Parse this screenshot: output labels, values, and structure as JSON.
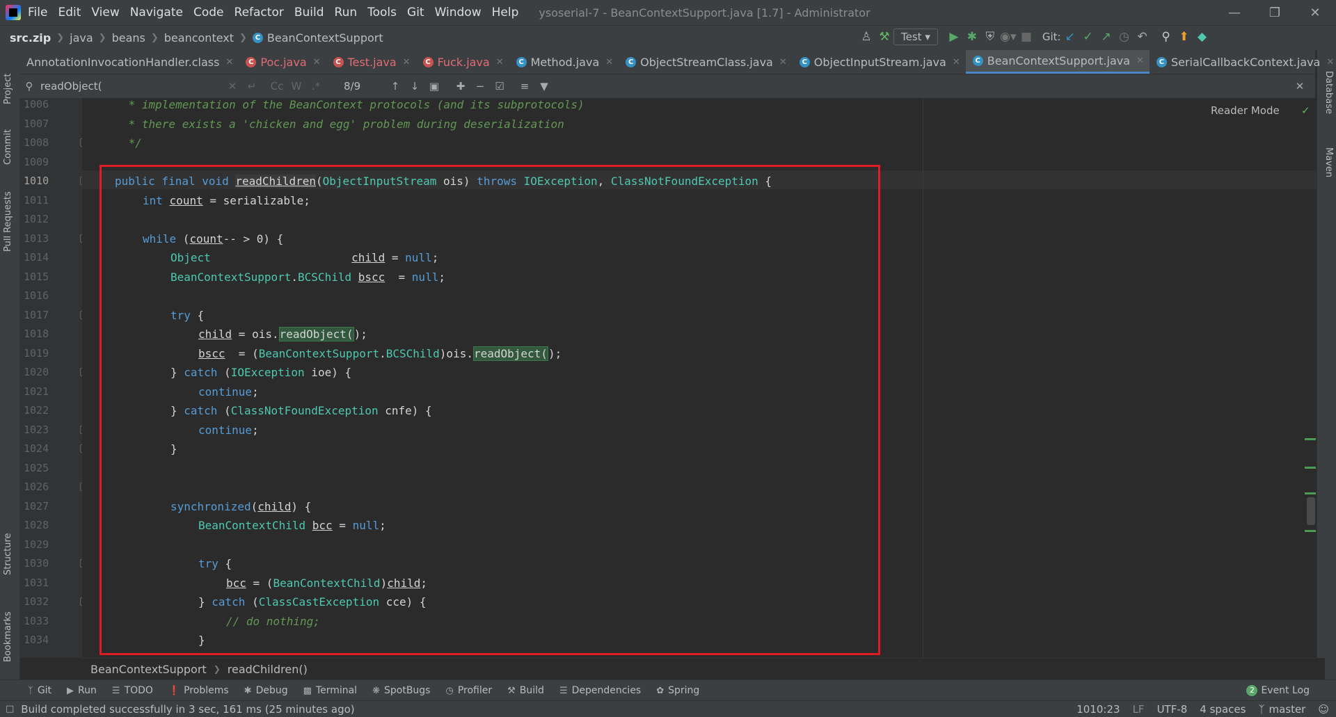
{
  "menubar": {
    "items": [
      "File",
      "Edit",
      "View",
      "Navigate",
      "Code",
      "Refactor",
      "Build",
      "Run",
      "Tools",
      "Git",
      "Window",
      "Help"
    ],
    "window_title": "ysoserial-7 - BeanContextSupport.java [1.7] - Administrator"
  },
  "navbar": {
    "crumbs": [
      "src.zip",
      "java",
      "beans",
      "beancontext",
      "BeanContextSupport"
    ],
    "run_config": "Test",
    "git_label": "Git:"
  },
  "tabs": [
    {
      "label": "AnnotationInvocationHandler.class",
      "error": false,
      "active": false
    },
    {
      "label": "Poc.java",
      "error": true,
      "active": false
    },
    {
      "label": "Test.java",
      "error": true,
      "active": false
    },
    {
      "label": "Fuck.java",
      "error": true,
      "active": false
    },
    {
      "label": "Method.java",
      "error": false,
      "active": false
    },
    {
      "label": "ObjectStreamClass.java",
      "error": false,
      "active": false
    },
    {
      "label": "ObjectInputStream.java",
      "error": false,
      "active": false
    },
    {
      "label": "BeanContextSupport.java",
      "error": false,
      "active": true
    },
    {
      "label": "SerialCallbackContext.java",
      "error": false,
      "active": false
    }
  ],
  "findbar": {
    "query": "readObject(",
    "match_count": "8/9",
    "opt_case": "Cc",
    "opt_word": "W",
    "opt_regex": ".*"
  },
  "editor": {
    "reader_mode": "Reader Mode",
    "line_numbers": [
      "1006",
      "1007",
      "1008",
      "1009",
      "1010",
      "1011",
      "1012",
      "1013",
      "1014",
      "1015",
      "1016",
      "1017",
      "1018",
      "1019",
      "1020",
      "1021",
      "1022",
      "1023",
      "1024",
      "1025",
      "1026",
      "1027",
      "1028",
      "1029",
      "1030",
      "1031",
      "1032",
      "1033",
      "1034"
    ]
  },
  "strip_left": [
    "Project",
    "Commit",
    "Pull Requests",
    "Structure",
    "Bookmarks"
  ],
  "strip_right": [
    "Database",
    "Maven"
  ],
  "bottom_crumbs": [
    "BeanContextSupport",
    "readChildren()"
  ],
  "tool_windows": [
    "Git",
    "Run",
    "TODO",
    "Problems",
    "Debug",
    "Terminal",
    "SpotBugs",
    "Profiler",
    "Build",
    "Dependencies",
    "Spring"
  ],
  "event_log": {
    "count": "2",
    "label": "Event Log"
  },
  "status": {
    "message": "Build completed successfully in 3 sec, 161 ms (25 minutes ago)",
    "position": "1010:23",
    "line_sep": "LF",
    "encoding": "UTF-8",
    "indent": "4 spaces",
    "branch": "master"
  }
}
